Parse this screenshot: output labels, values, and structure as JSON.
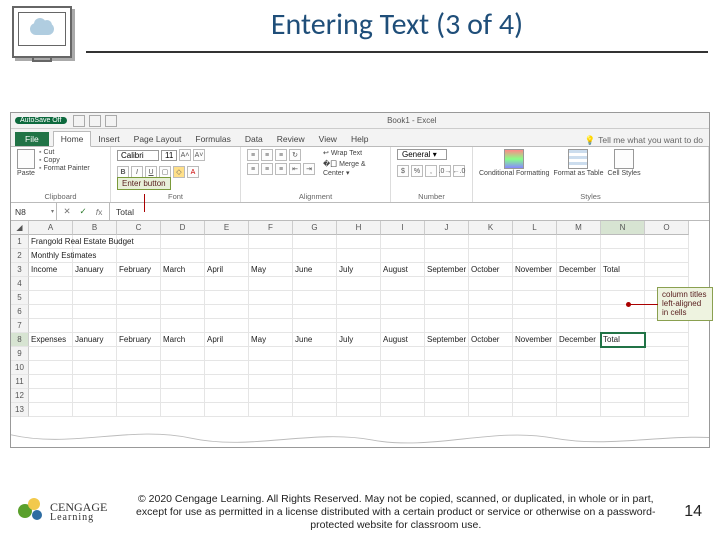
{
  "slide": {
    "title": "Entering Text (3 of 4)",
    "page_number": "14"
  },
  "copyright": "© 2020 Cengage Learning. All Rights Reserved. May not be copied, scanned, or duplicated, in whole or in part, except for use as permitted in a license distributed with a certain product or service or otherwise on a password-protected website for classroom use.",
  "logo": {
    "line1": "CENGAGE",
    "line2": "Learning"
  },
  "excel": {
    "autosave": "AutoSave  Off",
    "workbook": "Book1 - Excel",
    "tabs": {
      "file": "File",
      "home": "Home",
      "insert": "Insert",
      "page_layout": "Page Layout",
      "formulas": "Formulas",
      "data": "Data",
      "review": "Review",
      "view": "View",
      "help": "Help",
      "tellme": "Tell me what you want to do"
    },
    "ribbon": {
      "clipboard": {
        "label": "Clipboard",
        "paste": "Paste",
        "cut": "Cut",
        "copy": "Copy",
        "fmt": "Format Painter"
      },
      "font": {
        "label": "Font",
        "name": "Calibri",
        "size": "11"
      },
      "alignment": {
        "label": "Alignment",
        "wrap": "Wrap Text",
        "merge": "Merge & Center"
      },
      "number": {
        "label": "Number",
        "format": "General"
      },
      "styles": {
        "label": "Styles",
        "cond": "Conditional Formatting",
        "fmtas": "Format as Table",
        "cell": "Cell Styles"
      }
    },
    "callouts": {
      "enter_button": "Enter button",
      "column_titles": "column titles left-aligned in cells"
    },
    "fx": {
      "name_box": "N8",
      "formula": "Total"
    },
    "columns": [
      "A",
      "B",
      "C",
      "D",
      "E",
      "F",
      "G",
      "H",
      "I",
      "J",
      "K",
      "L",
      "M",
      "N",
      "O"
    ],
    "rows": {
      "1": {
        "A": "Frangold Real Estate Budget"
      },
      "2": {
        "A": "Monthly Estimates"
      },
      "3": {
        "A": "Income",
        "B": "January",
        "C": "February",
        "D": "March",
        "E": "April",
        "F": "May",
        "G": "June",
        "H": "July",
        "I": "August",
        "J": "September",
        "K": "October",
        "L": "November",
        "M": "December",
        "N": "Total"
      },
      "8": {
        "A": "Expenses",
        "B": "January",
        "C": "February",
        "D": "March",
        "E": "April",
        "F": "May",
        "G": "June",
        "H": "July",
        "I": "August",
        "J": "September",
        "K": "October",
        "L": "November",
        "M": "December",
        "N": "Total"
      }
    },
    "active_cell": "N8"
  }
}
